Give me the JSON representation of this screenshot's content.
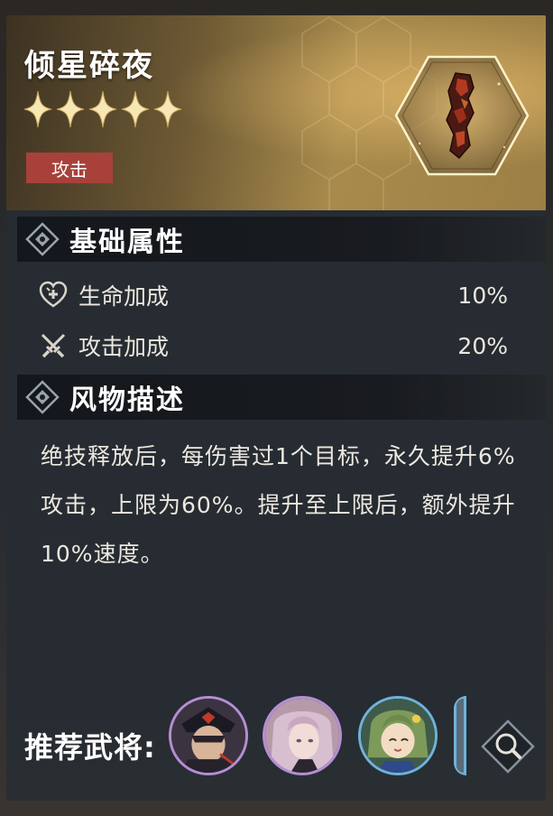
{
  "item": {
    "name": "倾星碎夜",
    "rarity_stars": 5,
    "type_tag": "攻击",
    "relic_icon": "crimson-crystal-relic"
  },
  "sections": {
    "base_attributes": {
      "title": "基础属性",
      "stats": [
        {
          "icon": "heart-plus-icon",
          "name": "生命加成",
          "value": "10%"
        },
        {
          "icon": "crossed-swords-icon",
          "name": "攻击加成",
          "value": "20%"
        }
      ]
    },
    "lore": {
      "title": "风物描述",
      "text": "绝技释放后，每伤害过1个目标，永久提升6%攻击，上限为60%。提升至上限后，额外提升10%速度。"
    }
  },
  "recommended": {
    "label": "推荐武将:",
    "avatars": [
      "general-officer-avatar",
      "pink-hair-avatar",
      "green-hair-avatar"
    ],
    "search_icon": "magnifier-icon"
  },
  "colors": {
    "accent_gold": "#f4e2a6",
    "tag_red": "#a8413a",
    "panel_dark": "#262c32",
    "header_dark": "#15181c"
  }
}
